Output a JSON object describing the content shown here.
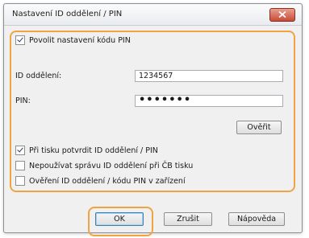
{
  "dialog": {
    "title": "Nastavení ID oddělení / PIN",
    "enable_pin_label": "Povolit nastavení kódu PIN",
    "enable_pin_checked": true,
    "dept_id_label": "ID oddělení:",
    "dept_id_value": "1234567",
    "pin_label": "PIN:",
    "pin_value": "•••••••",
    "verify_label": "Ověřit",
    "confirm_on_print_label": "Při tisku potvrdit ID oddělení / PIN",
    "confirm_on_print_checked": true,
    "no_dept_mgmt_bw_label": "Nepoužívat správu ID oddělení při ČB tisku",
    "no_dept_mgmt_bw_checked": false,
    "device_auth_label": "Ověření ID oddělení / kódu PIN v zařízení",
    "device_auth_checked": false,
    "ok_label": "OK",
    "cancel_label": "Zrušit",
    "help_label": "Nápověda"
  },
  "colors": {
    "highlight": "#f0a441",
    "close_button": "#c84b36"
  }
}
